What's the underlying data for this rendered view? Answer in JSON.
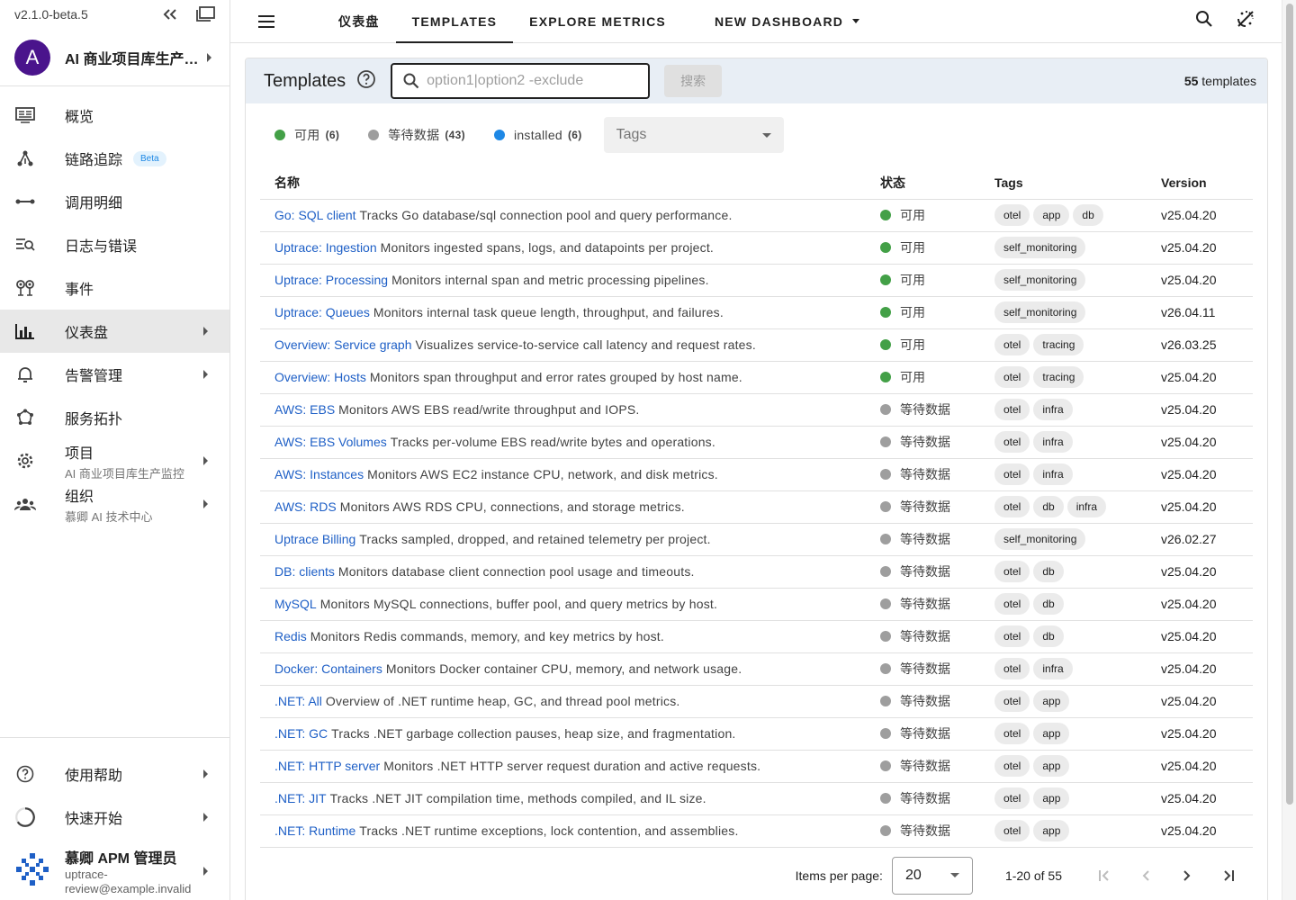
{
  "sidebar": {
    "version": "v2.1.0-beta.5",
    "project": {
      "initial": "A",
      "name": "AI 商业项目库生产监控"
    },
    "items": [
      {
        "label": "概览",
        "icon": "monitor-icon"
      },
      {
        "label": "链路追踪",
        "icon": "tracing-icon",
        "badge": "Beta"
      },
      {
        "label": "调用明细",
        "icon": "span-icon"
      },
      {
        "label": "日志与错误",
        "icon": "logs-icon"
      },
      {
        "label": "事件",
        "icon": "events-icon"
      },
      {
        "label": "仪表盘",
        "icon": "chart-icon"
      },
      {
        "label": "告警管理",
        "icon": "bell-icon"
      },
      {
        "label": "服务拓扑",
        "icon": "topology-icon"
      },
      {
        "label": "项目",
        "sub": "AI 商业项目库生产监控",
        "icon": "gear-icon"
      },
      {
        "label": "组织",
        "sub": "慕卿 AI 技术中心",
        "icon": "group-icon"
      }
    ],
    "bottom": {
      "help": "使用帮助",
      "quickstart": "快速开始",
      "user_name": "慕卿 APM 管理员",
      "user_email": "uptrace-review@example.invalid"
    }
  },
  "topbar": {
    "tabs": [
      "仪表盘",
      "TEMPLATES",
      "EXPLORE METRICS",
      "NEW DASHBOARD"
    ],
    "active_tab": "TEMPLATES"
  },
  "templates": {
    "title": "Templates",
    "search_placeholder": "option1|option2 -exclude",
    "search_button": "搜索",
    "count_num": "55",
    "count_label": "templates",
    "filters": [
      {
        "label": "可用",
        "count": "(6)",
        "color": "#43a047"
      },
      {
        "label": "等待数据",
        "count": "(43)",
        "color": "#9e9e9e"
      },
      {
        "label": "installed",
        "count": "(6)",
        "color": "#1e88e5"
      }
    ],
    "tags_placeholder": "Tags",
    "columns": [
      "名称",
      "状态",
      "Tags",
      "Version"
    ],
    "rows": [
      {
        "name": "Go: SQL client",
        "desc": "Tracks Go database/sql connection pool and query performance.",
        "status": "可用",
        "ok": true,
        "tags": [
          "otel",
          "app",
          "db"
        ],
        "version": "v25.04.20"
      },
      {
        "name": "Uptrace: Ingestion",
        "desc": "Monitors ingested spans, logs, and datapoints per project.",
        "status": "可用",
        "ok": true,
        "tags": [
          "self_monitoring"
        ],
        "version": "v25.04.20"
      },
      {
        "name": "Uptrace: Processing",
        "desc": "Monitors internal span and metric processing pipelines.",
        "status": "可用",
        "ok": true,
        "tags": [
          "self_monitoring"
        ],
        "version": "v25.04.20"
      },
      {
        "name": "Uptrace: Queues",
        "desc": "Monitors internal task queue length, throughput, and failures.",
        "status": "可用",
        "ok": true,
        "tags": [
          "self_monitoring"
        ],
        "version": "v26.04.11"
      },
      {
        "name": "Overview: Service graph",
        "desc": "Visualizes service-to-service call latency and request rates.",
        "status": "可用",
        "ok": true,
        "tags": [
          "otel",
          "tracing"
        ],
        "version": "v26.03.25"
      },
      {
        "name": "Overview: Hosts",
        "desc": "Monitors span throughput and error rates grouped by host name.",
        "status": "可用",
        "ok": true,
        "tags": [
          "otel",
          "tracing"
        ],
        "version": "v25.04.20"
      },
      {
        "name": "AWS: EBS",
        "desc": "Monitors AWS EBS read/write throughput and IOPS.",
        "status": "等待数据",
        "ok": false,
        "tags": [
          "otel",
          "infra"
        ],
        "version": "v25.04.20"
      },
      {
        "name": "AWS: EBS Volumes",
        "desc": "Tracks per-volume EBS read/write bytes and operations.",
        "status": "等待数据",
        "ok": false,
        "tags": [
          "otel",
          "infra"
        ],
        "version": "v25.04.20"
      },
      {
        "name": "AWS: Instances",
        "desc": "Monitors AWS EC2 instance CPU, network, and disk metrics.",
        "status": "等待数据",
        "ok": false,
        "tags": [
          "otel",
          "infra"
        ],
        "version": "v25.04.20"
      },
      {
        "name": "AWS: RDS",
        "desc": "Monitors AWS RDS CPU, connections, and storage metrics.",
        "status": "等待数据",
        "ok": false,
        "tags": [
          "otel",
          "db",
          "infra"
        ],
        "version": "v25.04.20"
      },
      {
        "name": "Uptrace Billing",
        "desc": "Tracks sampled, dropped, and retained telemetry per project.",
        "status": "等待数据",
        "ok": false,
        "tags": [
          "self_monitoring"
        ],
        "version": "v26.02.27"
      },
      {
        "name": "DB: clients",
        "desc": "Monitors database client connection pool usage and timeouts.",
        "status": "等待数据",
        "ok": false,
        "tags": [
          "otel",
          "db"
        ],
        "version": "v25.04.20"
      },
      {
        "name": "MySQL",
        "desc": "Monitors MySQL connections, buffer pool, and query metrics by host.",
        "status": "等待数据",
        "ok": false,
        "tags": [
          "otel",
          "db"
        ],
        "version": "v25.04.20"
      },
      {
        "name": "Redis",
        "desc": "Monitors Redis commands, memory, and key metrics by host.",
        "status": "等待数据",
        "ok": false,
        "tags": [
          "otel",
          "db"
        ],
        "version": "v25.04.20"
      },
      {
        "name": "Docker: Containers",
        "desc": "Monitors Docker container CPU, memory, and network usage.",
        "status": "等待数据",
        "ok": false,
        "tags": [
          "otel",
          "infra"
        ],
        "version": "v25.04.20"
      },
      {
        "name": ".NET: All",
        "desc": "Overview of .NET runtime heap, GC, and thread pool metrics.",
        "status": "等待数据",
        "ok": false,
        "tags": [
          "otel",
          "app"
        ],
        "version": "v25.04.20"
      },
      {
        "name": ".NET: GC",
        "desc": "Tracks .NET garbage collection pauses, heap size, and fragmentation.",
        "status": "等待数据",
        "ok": false,
        "tags": [
          "otel",
          "app"
        ],
        "version": "v25.04.20"
      },
      {
        "name": ".NET: HTTP server",
        "desc": "Monitors .NET HTTP server request duration and active requests.",
        "status": "等待数据",
        "ok": false,
        "tags": [
          "otel",
          "app"
        ],
        "version": "v25.04.20"
      },
      {
        "name": ".NET: JIT",
        "desc": "Tracks .NET JIT compilation time, methods compiled, and IL size.",
        "status": "等待数据",
        "ok": false,
        "tags": [
          "otel",
          "app"
        ],
        "version": "v25.04.20"
      },
      {
        "name": ".NET: Runtime",
        "desc": "Tracks .NET runtime exceptions, lock contention, and assemblies.",
        "status": "等待数据",
        "ok": false,
        "tags": [
          "otel",
          "app"
        ],
        "version": "v25.04.20"
      }
    ],
    "pager": {
      "items_per_page_label": "Items per page:",
      "items_per_page": "20",
      "range": "1-20 of 55"
    }
  },
  "colors": {
    "ok": "#43a047",
    "pending": "#9e9e9e",
    "link": "#1e5fc6",
    "accent": "#4a148c"
  }
}
